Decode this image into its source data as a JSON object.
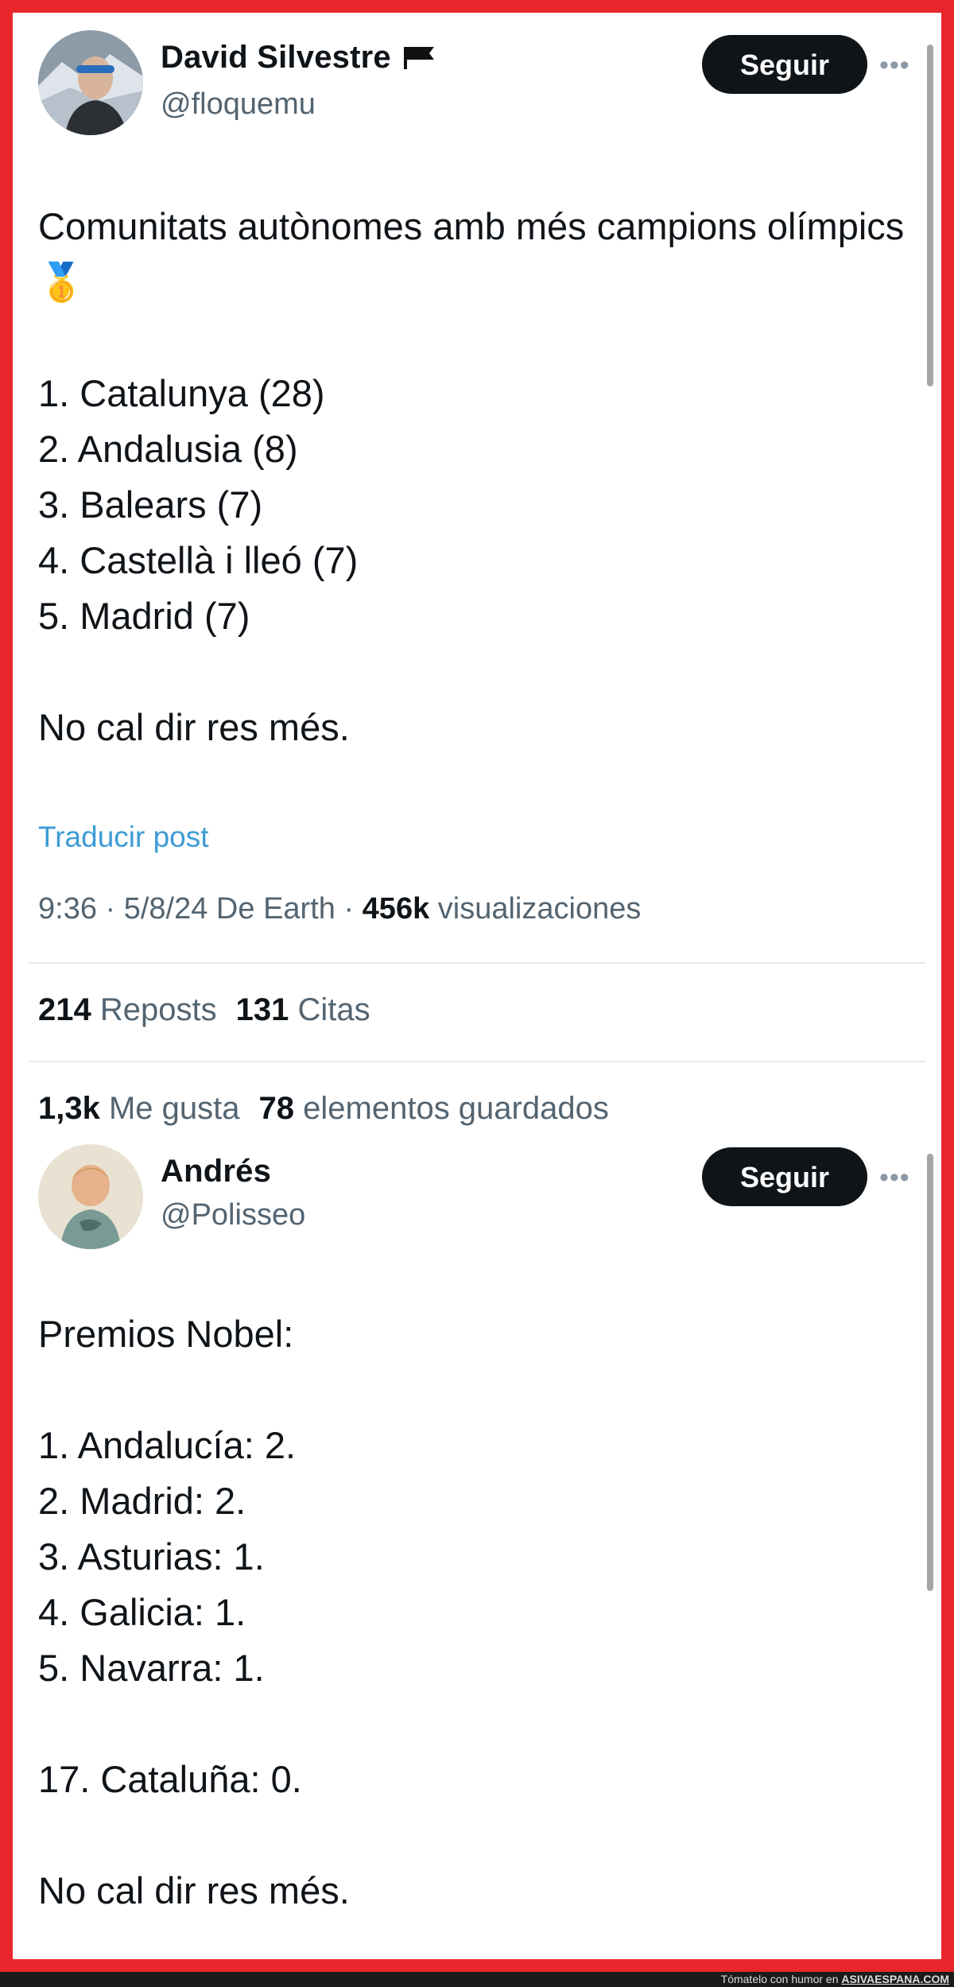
{
  "tweet1": {
    "author_name": "David Silvestre",
    "handle": "@floquemu",
    "follow_label": "Seguir",
    "more_label": "•••",
    "text": "Comunitats autònomes amb més campions olímpics 🥇\n\n1. Catalunya (28)\n2. Andalusia (8)\n3. Balears (7)\n4. Castellà i lleó (7)\n5. Madrid (7)\n\nNo cal dir res més.",
    "translate_label": "Traducir post",
    "meta_time": "9:36 · 5/8/24 De Earth · ",
    "views_count": "456k",
    "views_label": " visualizaciones",
    "reposts_count": "214",
    "reposts_label": "Reposts",
    "quotes_count": "131",
    "quotes_label": "Citas",
    "likes_count": "1,3k",
    "likes_label": "Me gusta",
    "saves_count": "78",
    "saves_label": "elementos guardados"
  },
  "tweet2": {
    "author_name": "Andrés",
    "handle": "@Polisseo",
    "follow_label": "Seguir",
    "more_label": "•••",
    "text": "Premios Nobel:\n\n1. Andalucía: 2.\n2. Madrid: 2.\n3. Asturias: 1.\n4. Galicia: 1.\n5. Navarra: 1.\n\n17. Cataluña: 0.\n\nNo cal dir res més."
  },
  "footer": {
    "text_plain": "Tómatelo con humor en ",
    "text_site": "ASIVAESPANA.COM"
  },
  "colors": {
    "frame": "#e8262b",
    "link": "#1d9bf0",
    "button": "#0f1419"
  }
}
